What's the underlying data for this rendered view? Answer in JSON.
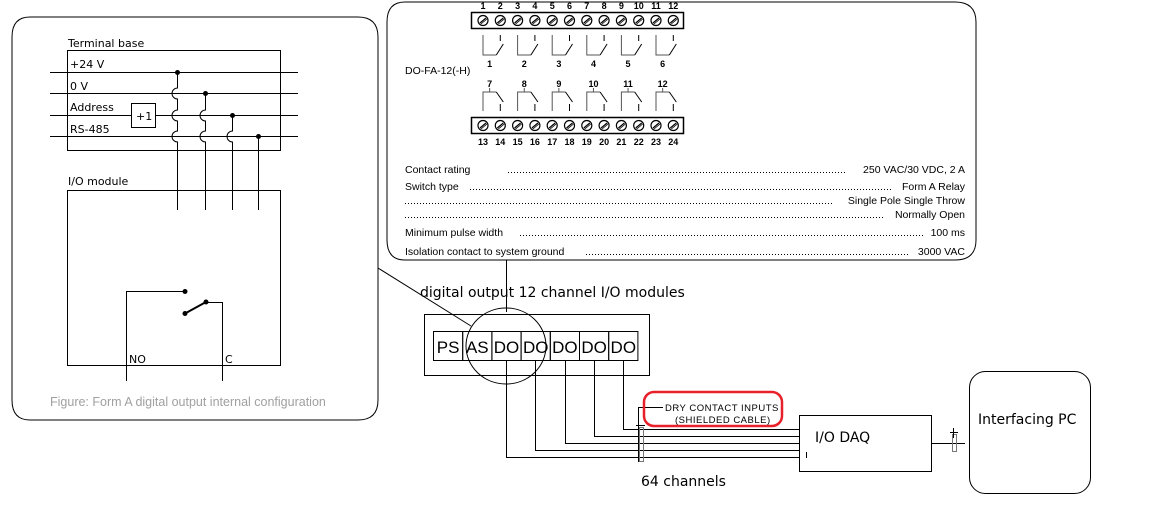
{
  "internal_config_panel": {
    "terminal_base_label": "Terminal base",
    "bus_lines": [
      "+24 V",
      "0 V",
      "Address",
      "RS-485"
    ],
    "address_increment_label": "+1",
    "io_module_label": "I/O module",
    "no_label": "NO",
    "c_label": "C",
    "caption": "Figure: Form A digital output internal configuration"
  },
  "module_spec_panel": {
    "model_label": "DO-FA-12(-H)",
    "top_terminals": [
      "1",
      "2",
      "3",
      "4",
      "5",
      "6",
      "7",
      "8",
      "9",
      "10",
      "11",
      "12"
    ],
    "top_relays": [
      "1",
      "2",
      "3",
      "4",
      "5",
      "6"
    ],
    "bottom_relays": [
      "7",
      "8",
      "9",
      "10",
      "11",
      "12"
    ],
    "bottom_terminals": [
      "13",
      "14",
      "15",
      "16",
      "17",
      "18",
      "19",
      "20",
      "21",
      "22",
      "23",
      "24"
    ],
    "specs": [
      {
        "label": "Contact rating",
        "value": "250 VAC/30 VDC, 2 A"
      },
      {
        "label": "Switch type",
        "value": "Form A Relay"
      },
      {
        "label": "",
        "value": "Single Pole Single Throw"
      },
      {
        "label": "",
        "value": "Normally Open"
      },
      {
        "label": "Minimum pulse width",
        "value": "100 ms"
      },
      {
        "label": "Isolation contact to system ground",
        "value": "3000 VAC"
      }
    ]
  },
  "system": {
    "modules_title": "digital output 12 channel I/O modules",
    "rack_slots": [
      "PS",
      "AS",
      "DO",
      "DO",
      "DO",
      "DO",
      "DO"
    ],
    "dry_contact_line1": "DRY CONTACT INPUTS",
    "dry_contact_line2": "(SHIELDED CABLE)",
    "channels_label": "64 channels",
    "daq_label": "I/O DAQ",
    "pc_label": "Interfacing PC",
    "highlight_color": "#e8202a"
  }
}
